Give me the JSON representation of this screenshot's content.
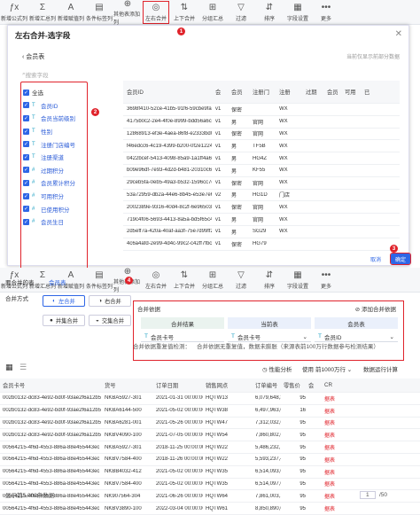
{
  "toolbar_top": [
    {
      "icon": "ƒx",
      "label": "新增公式列",
      "name": "formula"
    },
    {
      "icon": "Σ",
      "label": "新增汇总列",
      "name": "summary"
    },
    {
      "icon": "A",
      "label": "新增赋值列",
      "name": "assign"
    },
    {
      "icon": "▤",
      "label": "条件标签列",
      "name": "condition"
    },
    {
      "icon": "⊕",
      "label": "其他表添加列",
      "name": "other"
    },
    {
      "icon": "◎",
      "label": "左右合并",
      "name": "lr-merge"
    },
    {
      "icon": "⇅",
      "label": "上下合并",
      "name": "ud-merge"
    },
    {
      "icon": "⊞",
      "label": "分组汇总",
      "name": "group"
    },
    {
      "icon": "▽",
      "label": "过滤",
      "name": "filter"
    },
    {
      "icon": "⇵",
      "label": "排序",
      "name": "sort"
    },
    {
      "icon": "▦",
      "label": "字段设置",
      "name": "field-setting"
    },
    {
      "icon": "•••",
      "label": "更多",
      "name": "more"
    }
  ],
  "badges": {
    "b1": "1",
    "b2": "2",
    "b3": "3",
    "b4": "4"
  },
  "dialog": {
    "title": "左右合并-选字段",
    "back_label": "会员表",
    "search_placeholder": "搜索字段",
    "hint": "当前仅显示前部分数据",
    "cancel": "取消",
    "ok": "确定",
    "fields": [
      "全选",
      "会员ID",
      "会员当前级别",
      "性别",
      "注册门店编号",
      "注册渠道",
      "过期积分",
      "会员累计积分",
      "可用积分",
      "已使用积分",
      "会员生日"
    ],
    "columns": [
      "会员ID",
      "会",
      "会员",
      "注册门",
      "注册",
      "过期",
      "会员",
      "可用",
      "已"
    ],
    "rows": [
      [
        "3698f410-52ce-41b5-91f6-59cbe9fa0f20",
        "v1",
        "保密",
        "",
        "WX",
        "",
        "",
        "",
        ""
      ],
      [
        "4175b0c2-2e4-4f0e-8999-bdd56a6cac30",
        "v1",
        "男",
        "官网",
        "WX",
        "",
        "",
        "",
        ""
      ],
      [
        "12868913-ef3e-4aea-86f8-e2333bd0eee8",
        "v1",
        "保密",
        "官网",
        "WX",
        "",
        "",
        "",
        ""
      ],
      [
        "f46edcc6-4c19-4399-b200-0f2e12243133",
        "v1",
        "男",
        "TF5B",
        "WX",
        "",
        "",
        "",
        ""
      ],
      [
        "0422bcef-5413-4098-85a9-1a1ff4a65b27",
        "v1",
        "男",
        "HG4Z",
        "WX",
        "",
        "",
        "",
        ""
      ],
      [
        "b09e96df-7e93-4d2d-b481-20310c650ac7",
        "v1",
        "男",
        "KF55",
        "WX",
        "",
        "",
        "",
        ""
      ],
      [
        "29ceb5fa-0eb5-49a3-b532-1596cc7deda6",
        "v1",
        "保密",
        "官网",
        "WX",
        "",
        "",
        "",
        ""
      ],
      [
        "53a72959-db2a-44e6-8b45-e53e7e6f13de",
        "v2",
        "男",
        "HG1D",
        "门店",
        "",
        "",
        "",
        ""
      ],
      [
        "2002389e-9316-40d4-8c2f-6e965030ce1c",
        "v1",
        "保密",
        "官网",
        "WX",
        "",
        "",
        "",
        ""
      ],
      [
        "719c4f06-5693-4413-8a5a-bd5f65c46ba3",
        "v1",
        "男",
        "官网",
        "WX",
        "",
        "",
        "",
        ""
      ],
      [
        "2d5eff7a-420a-40af-aa3f-75e7d99ff2b6",
        "v1",
        "男",
        "SG29",
        "WX",
        "",
        "",
        "",
        ""
      ],
      [
        "4c6a4afd-2e99-4d4c-99c2-c42ff7fbc2d2",
        "v1",
        "保密",
        "HG79",
        "",
        "",
        "",
        "",
        ""
      ]
    ]
  },
  "lower": {
    "merge_table_label": "要合并的表",
    "merge_table_value": "会员表",
    "merge_mode_label": "合并方式",
    "modes": [
      "左合并",
      "右合并",
      "并集合并",
      "交集合并"
    ],
    "merge_basis_label": "合并依据",
    "add_basis": "添加合并依据",
    "col_result": "合并结果",
    "col_current": "当前表",
    "col_member": "会员表",
    "sel1": "会员卡号",
    "sel2": "会员卡号",
    "sel3": "会员ID",
    "note": "合并依据重复值检测：",
    "note2": "合并依据无重复值，数据未膨胀（来源表前100万行数据参与检测结果）",
    "perf": "性能分析",
    "use": "使用",
    "rows_opt": "前1000万行",
    "data_perf": "数据运行计算"
  },
  "bottom": {
    "columns": [
      "会员卡号",
      "货号",
      "订单日期",
      "销售网点",
      "订单编号",
      "零售价",
      "会",
      "CR"
    ],
    "rows": [
      [
        "002b0132-dc83-4e92-bd0f-93ae2f6a12b5",
        "NKBA5927-301",
        "2021-01-31 00:00:00",
        "HQTW13",
        "6,079,648,345",
        "95",
        "",
        "据表"
      ],
      [
        "002b0132-dc83-4e92-bd0f-93ae2f6a12b5",
        "NKBA6144-500",
        "2021-05-02 00:00:00",
        "HQTW38",
        "6,497,963,076",
        "16",
        "",
        "据表"
      ],
      [
        "002b0132-dc83-4e92-bd0f-93ae2f6a12b5",
        "NKBA6281-001",
        "2021-05-26 00:00:00",
        "HQTW47",
        "7,312,032,658",
        "95",
        "",
        "据表"
      ],
      [
        "002b0132-dc83-4e92-bd0f-93ae2f6a12b5",
        "NKBV4090-100",
        "2021-07-05 00:00:00",
        "HQTW54",
        "7,860,802,658",
        "95",
        "",
        "据表"
      ],
      [
        "00564215-4f6d-4553-886a-88e455443ec",
        "NKBA5927-301",
        "2018-11-25 00:00:00",
        "HQTW22",
        "5,486,232,776",
        "95",
        "",
        "据表"
      ],
      [
        "00564215-4f6d-4553-886a-88e455443ec",
        "NKBV7584-400",
        "2018-11-26 00:00:00",
        "HQTW22",
        "5,593,237,443",
        "95",
        "",
        "据表"
      ],
      [
        "00564215-4f6d-4553-886a-88e455443ec",
        "NKBB4032-412",
        "2021-05-02 00:00:00",
        "HQTW35",
        "6,514,093,076",
        "95",
        "",
        "据表"
      ],
      [
        "00564215-4f6d-4553-886a-88e455443ec",
        "NKBV7584-400",
        "2021-05-02 00:00:00",
        "HQTW35",
        "6,514,097,043",
        "95",
        "",
        "据表"
      ],
      [
        "00564215-4f6d-4553-886a-88e455443ec",
        "NK907564-304",
        "2021-06-26 00:00:00",
        "HQTW64",
        "7,861,003,148",
        "95",
        "",
        "据表"
      ],
      [
        "00564215-4f6d-4553-886a-88e455443ec",
        "NKBV3890-100",
        "2022-03-04 00:00:00",
        "HQTW61",
        "8,850,890,045",
        "95",
        "",
        "据表"
      ]
    ],
    "footer": "显示前5,000条数据",
    "page": "1",
    "per_page": "/50"
  }
}
